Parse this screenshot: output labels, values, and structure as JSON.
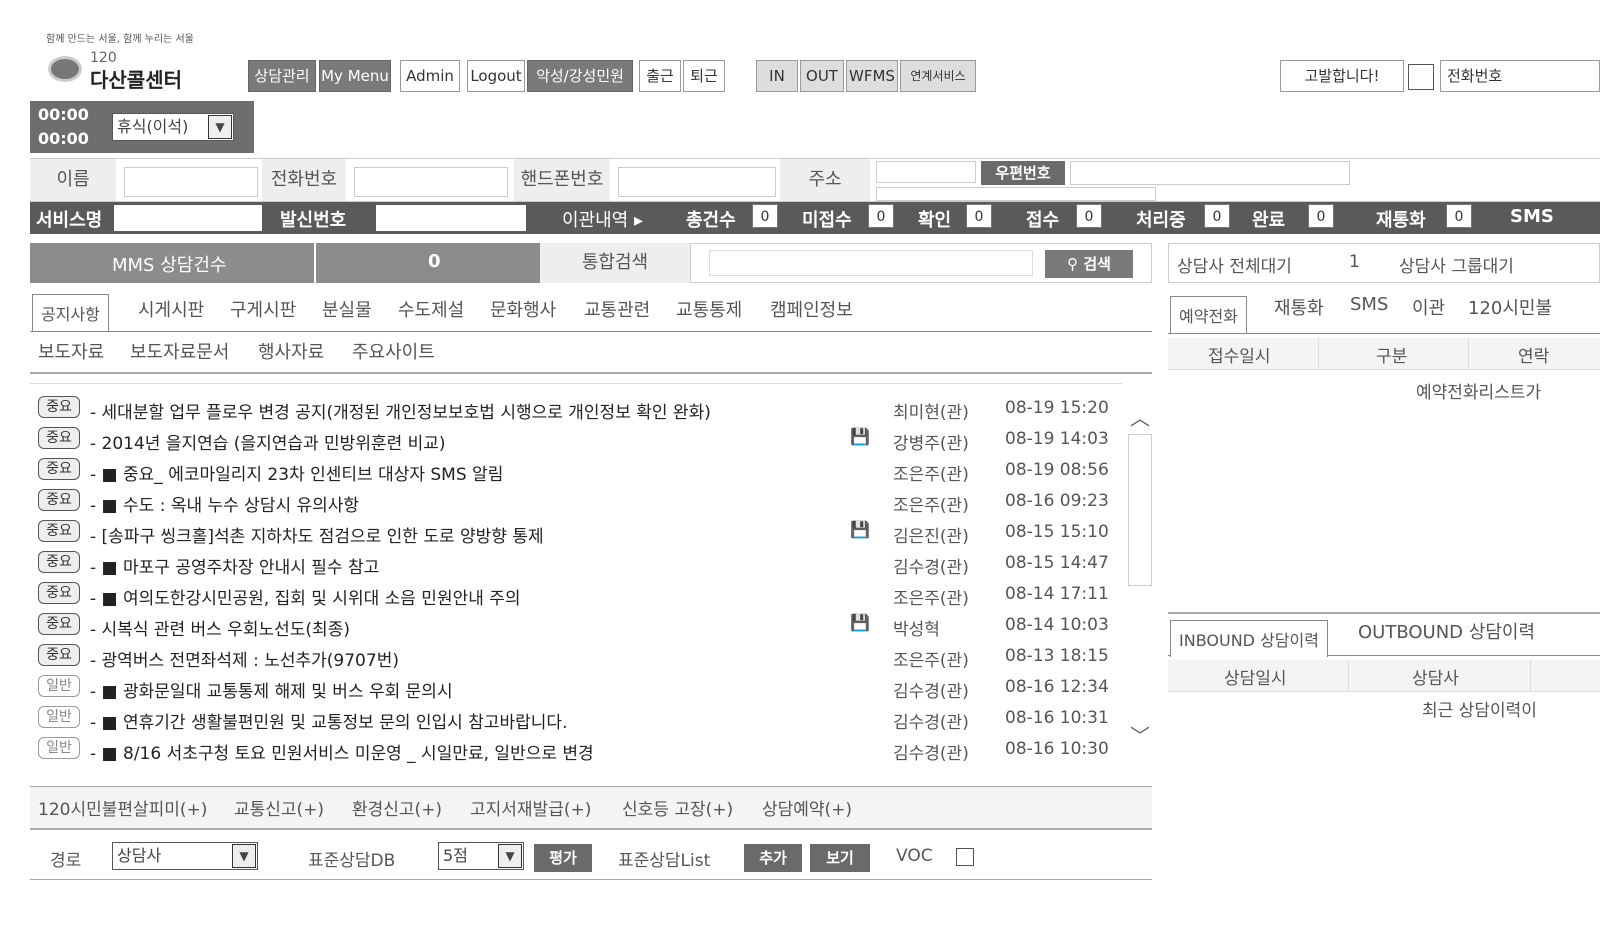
{
  "header": {
    "slogan": "함께 만드는 서울, 함께 누리는 서울",
    "logo_number": "120",
    "logo_name": "다산콜센터"
  },
  "topnav": {
    "counsel": "상담관리",
    "mymenu": "My Menu",
    "admin": "Admin",
    "logout": "Logout",
    "complaint": "악성/강성민원",
    "checkin": "출근",
    "checkout": "퇴근",
    "in": "IN",
    "out": "OUT",
    "wfms": "WFMS",
    "linked": "연계서비스",
    "report": "고발합니다!",
    "phone_label": "전화번호"
  },
  "timer": {
    "time1": "00:00",
    "time2": "00:00",
    "status_select": "휴식(이석)"
  },
  "customer": {
    "name_label": "이름",
    "phone_label": "전화번호",
    "mobile_label": "핸드폰번호",
    "address_label": "주소",
    "zip_button": "우편번호"
  },
  "statusbar": {
    "service_label": "서비스명",
    "caller_label": "발신번호",
    "transfer_label": "이관내역 ▸",
    "total_label": "총건수",
    "total": "0",
    "unreceived_label": "미접수",
    "unreceived": "0",
    "confirm_label": "확인",
    "confirm": "0",
    "received_label": "접수",
    "received": "0",
    "processing_label": "처리중",
    "processing": "0",
    "done_label": "완료",
    "done": "0",
    "recall_label": "재통화",
    "recall": "0",
    "sms_label": "SMS"
  },
  "mms": {
    "label": "MMS 상담건수",
    "count": "0",
    "search_label": "통합검색",
    "search_button": "검색"
  },
  "tabs_row1": [
    "공지사항",
    "시게시판",
    "구게시판",
    "분실물",
    "수도제설",
    "문화행사",
    "교통관련",
    "교통통제",
    "캠페인정보"
  ],
  "tabs_row2": [
    "보도자료",
    "보도자료문서",
    "행사자료",
    "주요사이트"
  ],
  "notices": [
    {
      "type": "중요",
      "title": "- 세대분할 업무 플로우 변경 공지(개정된 개인정보보호법 시행으로 개인정보 확인 완화)",
      "file": false,
      "author": "최미현(관)",
      "date": "08-19 15:20"
    },
    {
      "type": "중요",
      "title": "- 2014년 을지연습 (을지연습과 민방위훈련 비교)",
      "file": true,
      "author": "강병주(관)",
      "date": "08-19 14:03"
    },
    {
      "type": "중요",
      "title": "- ■ 중요_ 에코마일리지 23차 인센티브 대상자 SMS 알림",
      "file": false,
      "author": "조은주(관)",
      "date": "08-19 08:56"
    },
    {
      "type": "중요",
      "title": "- ■ 수도 : 옥내 누수 상담시 유의사항",
      "file": false,
      "author": "조은주(관)",
      "date": "08-16 09:23"
    },
    {
      "type": "중요",
      "title": "- [송파구 씽크홀]석촌 지하차도 점검으로 인한 도로 양방향 통제",
      "file": true,
      "author": "김은진(관)",
      "date": "08-15 15:10"
    },
    {
      "type": "중요",
      "title": "- ■ 마포구 공영주차장 안내시 필수 참고",
      "file": false,
      "author": "김수경(관)",
      "date": "08-15 14:47"
    },
    {
      "type": "중요",
      "title": "- ■ 여의도한강시민공원, 집회 및 시위대 소음 민원안내 주의",
      "file": false,
      "author": "조은주(관)",
      "date": "08-14 17:11"
    },
    {
      "type": "중요",
      "title": "- 시복식 관련 버스 우회노선도(최종)",
      "file": true,
      "author": "박성혁",
      "date": "08-14 10:03"
    },
    {
      "type": "중요",
      "title": "- 광역버스 전면좌석제 : 노선추가(9707번)",
      "file": false,
      "author": "조은주(관)",
      "date": "08-13 18:15"
    },
    {
      "type": "일반",
      "title": "- ■ 광화문일대 교통통제 해제 및 버스 우회 문의시",
      "file": false,
      "author": "김수경(관)",
      "date": "08-16 12:34"
    },
    {
      "type": "일반",
      "title": "- ■ 연휴기간 생활불편민원 및 교통정보 문의 인입시 참고바랍니다.",
      "file": false,
      "author": "김수경(관)",
      "date": "08-16 10:31"
    },
    {
      "type": "일반",
      "title": "- ■ 8/16 서초구청 토요 민원서비스 미운영 _ 시일만료, 일반으로 변경",
      "file": false,
      "author": "김수경(관)",
      "date": "08-16 10:30"
    }
  ],
  "bottom_links": [
    "120시민불편살피미(+)",
    "교통신고(+)",
    "환경신고(+)",
    "고지서재발급(+)",
    "신호등 고장(+)",
    "상담예약(+)"
  ],
  "bottom_form": {
    "route_label": "경로",
    "route_value": "상담사",
    "db_label": "표준상담DB",
    "score_value": "5점",
    "eval_button": "평가",
    "list_label": "표준상담List",
    "add_button": "추가",
    "view_button": "보기",
    "voc_label": "VOC"
  },
  "right_panel": {
    "wait_total_label": "상담사 전체대기",
    "wait_total": "1",
    "wait_group_label": "상담사 그룹대기",
    "tabs": [
      "예약전화",
      "재통화",
      "SMS",
      "이관",
      "120시민불"
    ],
    "col1": "접수일시",
    "col2": "구분",
    "col3": "연락",
    "empty_msg": "예약전화리스트가",
    "hist_tabs": [
      "INBOUND 상담이력",
      "OUTBOUND 상담이력"
    ],
    "hist_col1": "상담일시",
    "hist_col2": "상담사",
    "hist_empty": "최근 상담이력이"
  }
}
